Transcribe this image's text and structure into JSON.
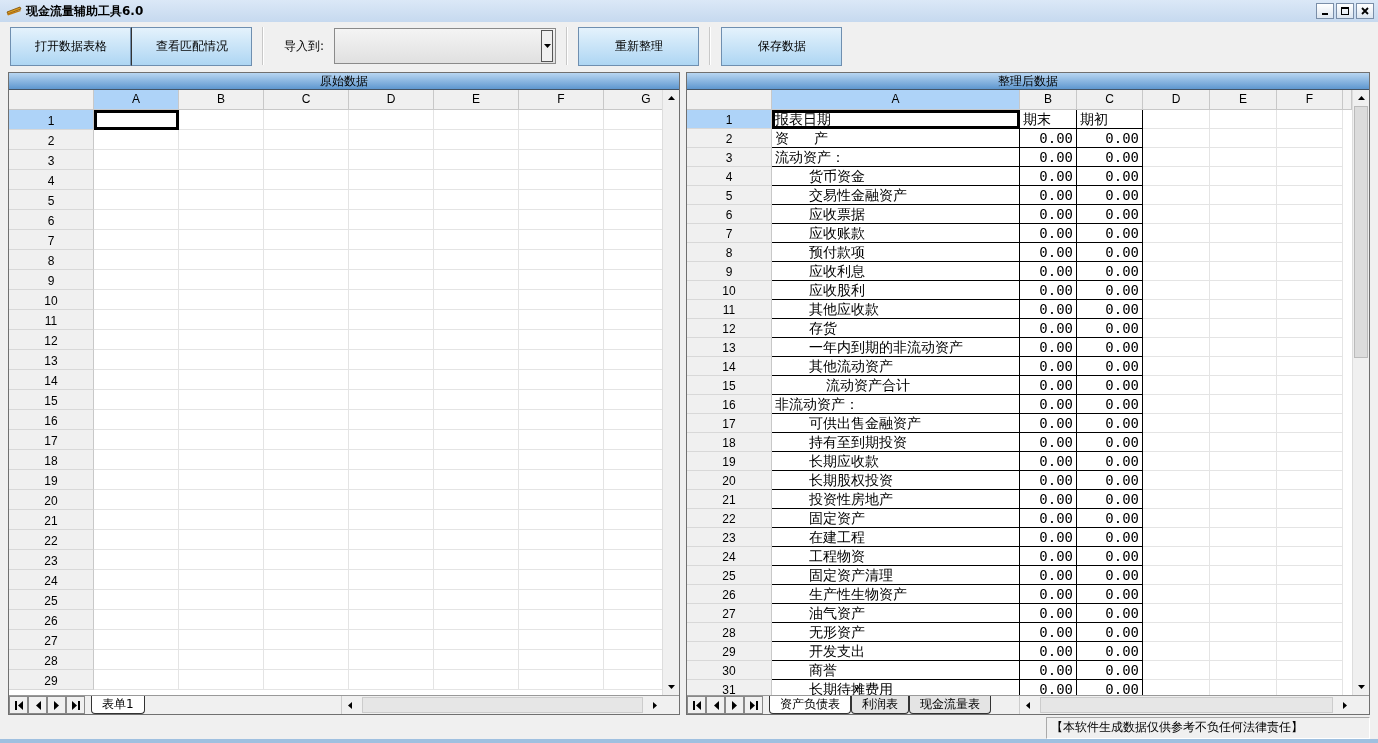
{
  "window": {
    "title": "现金流量辅助工具6.0"
  },
  "toolbar": {
    "file_buttons": [
      "打开数据表格",
      "查看匹配情况"
    ],
    "import_label": "导入到:",
    "action_buttons": [
      "重新整理",
      "保存数据"
    ]
  },
  "panes": [
    {
      "title": "原始数据",
      "columns": [
        {
          "label": "A",
          "selected": true
        },
        {
          "label": "B",
          "selected": false
        },
        {
          "label": "C",
          "selected": false
        },
        {
          "label": "D",
          "selected": false
        },
        {
          "label": "E",
          "selected": false
        },
        {
          "label": "F",
          "selected": false
        },
        {
          "label": "G",
          "selected": false
        }
      ],
      "rows": [
        {
          "number": "1",
          "selected": true
        },
        {
          "number": "2",
          "selected": false
        },
        {
          "number": "3",
          "selected": false
        },
        {
          "number": "4",
          "selected": false
        },
        {
          "number": "5",
          "selected": false
        },
        {
          "number": "6",
          "selected": false
        },
        {
          "number": "7",
          "selected": false
        },
        {
          "number": "8",
          "selected": false
        },
        {
          "number": "9",
          "selected": false
        },
        {
          "number": "10",
          "selected": false
        },
        {
          "number": "11",
          "selected": false
        },
        {
          "number": "12",
          "selected": false
        },
        {
          "number": "13",
          "selected": false
        },
        {
          "number": "14",
          "selected": false
        },
        {
          "number": "15",
          "selected": false
        },
        {
          "number": "16",
          "selected": false
        },
        {
          "number": "17",
          "selected": false
        },
        {
          "number": "18",
          "selected": false
        },
        {
          "number": "19",
          "selected": false
        },
        {
          "number": "20",
          "selected": false
        },
        {
          "number": "21",
          "selected": false
        },
        {
          "number": "22",
          "selected": false
        },
        {
          "number": "23",
          "selected": false
        },
        {
          "number": "24",
          "selected": false
        },
        {
          "number": "25",
          "selected": false
        },
        {
          "number": "26",
          "selected": false
        },
        {
          "number": "27",
          "selected": false
        },
        {
          "number": "28",
          "selected": false
        },
        {
          "number": "29",
          "selected": false
        }
      ],
      "sheet_tabs": [
        {
          "label": "表单1",
          "selected": true
        }
      ]
    },
    {
      "title": "整理后数据",
      "columns": [
        {
          "label": "A",
          "selected": true
        },
        {
          "label": "B",
          "selected": false
        },
        {
          "label": "C",
          "selected": false
        },
        {
          "label": "D",
          "selected": false
        },
        {
          "label": "E",
          "selected": false
        },
        {
          "label": "F",
          "selected": false
        }
      ],
      "rows": [
        {
          "number": "1",
          "selected": true,
          "kind": "header",
          "cells": [
            "报表日期",
            "期末",
            "期初"
          ]
        },
        {
          "number": "2",
          "selected": false,
          "kind": "item",
          "cells": [
            "资   产",
            "0.00",
            "0.00"
          ]
        },
        {
          "number": "3",
          "selected": false,
          "kind": "item",
          "cells": [
            "流动资产：",
            "0.00",
            "0.00"
          ]
        },
        {
          "number": "4",
          "selected": false,
          "kind": "item",
          "cells": [
            "    货币资金",
            "0.00",
            "0.00"
          ]
        },
        {
          "number": "5",
          "selected": false,
          "kind": "item",
          "cells": [
            "    交易性金融资产",
            "0.00",
            "0.00"
          ]
        },
        {
          "number": "6",
          "selected": false,
          "kind": "item",
          "cells": [
            "    应收票据",
            "0.00",
            "0.00"
          ]
        },
        {
          "number": "7",
          "selected": false,
          "kind": "item",
          "cells": [
            "    应收账款",
            "0.00",
            "0.00"
          ]
        },
        {
          "number": "8",
          "selected": false,
          "kind": "item",
          "cells": [
            "    预付款项",
            "0.00",
            "0.00"
          ]
        },
        {
          "number": "9",
          "selected": false,
          "kind": "item",
          "cells": [
            "    应收利息",
            "0.00",
            "0.00"
          ]
        },
        {
          "number": "10",
          "selected": false,
          "kind": "item",
          "cells": [
            "    应收股利",
            "0.00",
            "0.00"
          ]
        },
        {
          "number": "11",
          "selected": false,
          "kind": "item",
          "cells": [
            "    其他应收款",
            "0.00",
            "0.00"
          ]
        },
        {
          "number": "12",
          "selected": false,
          "kind": "item",
          "cells": [
            "    存货",
            "0.00",
            "0.00"
          ]
        },
        {
          "number": "13",
          "selected": false,
          "kind": "item",
          "cells": [
            "    一年内到期的非流动资产",
            "0.00",
            "0.00"
          ]
        },
        {
          "number": "14",
          "selected": false,
          "kind": "item",
          "cells": [
            "    其他流动资产",
            "0.00",
            "0.00"
          ]
        },
        {
          "number": "15",
          "selected": false,
          "kind": "item",
          "cells": [
            "      流动资产合计",
            "0.00",
            "0.00"
          ]
        },
        {
          "number": "16",
          "selected": false,
          "kind": "item",
          "cells": [
            "非流动资产：",
            "0.00",
            "0.00"
          ]
        },
        {
          "number": "17",
          "selected": false,
          "kind": "item",
          "cells": [
            "    可供出售金融资产",
            "0.00",
            "0.00"
          ]
        },
        {
          "number": "18",
          "selected": false,
          "kind": "item",
          "cells": [
            "    持有至到期投资",
            "0.00",
            "0.00"
          ]
        },
        {
          "number": "19",
          "selected": false,
          "kind": "item",
          "cells": [
            "    长期应收款",
            "0.00",
            "0.00"
          ]
        },
        {
          "number": "20",
          "selected": false,
          "kind": "item",
          "cells": [
            "    长期股权投资",
            "0.00",
            "0.00"
          ]
        },
        {
          "number": "21",
          "selected": false,
          "kind": "item",
          "cells": [
            "    投资性房地产",
            "0.00",
            "0.00"
          ]
        },
        {
          "number": "22",
          "selected": false,
          "kind": "item",
          "cells": [
            "    固定资产",
            "0.00",
            "0.00"
          ]
        },
        {
          "number": "23",
          "selected": false,
          "kind": "item",
          "cells": [
            "    在建工程",
            "0.00",
            "0.00"
          ]
        },
        {
          "number": "24",
          "selected": false,
          "kind": "item",
          "cells": [
            "    工程物资",
            "0.00",
            "0.00"
          ]
        },
        {
          "number": "25",
          "selected": false,
          "kind": "item",
          "cells": [
            "    固定资产清理",
            "0.00",
            "0.00"
          ]
        },
        {
          "number": "26",
          "selected": false,
          "kind": "item",
          "cells": [
            "    生产性生物资产",
            "0.00",
            "0.00"
          ]
        },
        {
          "number": "27",
          "selected": false,
          "kind": "item",
          "cells": [
            "    油气资产",
            "0.00",
            "0.00"
          ]
        },
        {
          "number": "28",
          "selected": false,
          "kind": "item",
          "cells": [
            "    无形资产",
            "0.00",
            "0.00"
          ]
        },
        {
          "number": "29",
          "selected": false,
          "kind": "item",
          "cells": [
            "    开发支出",
            "0.00",
            "0.00"
          ]
        },
        {
          "number": "30",
          "selected": false,
          "kind": "item",
          "cells": [
            "    商誉",
            "0.00",
            "0.00"
          ]
        },
        {
          "number": "31",
          "selected": false,
          "kind": "item",
          "cells": [
            "    长期待摊费用",
            "0.00",
            "0.00"
          ]
        }
      ],
      "sheet_tabs": [
        {
          "label": "资产负债表",
          "selected": true
        },
        {
          "label": "利润表",
          "selected": false
        },
        {
          "label": "现金流量表",
          "selected": false
        }
      ]
    }
  ],
  "status_bar": {
    "notice": "【本软件生成数据仅供参考不负任何法律责任】"
  }
}
